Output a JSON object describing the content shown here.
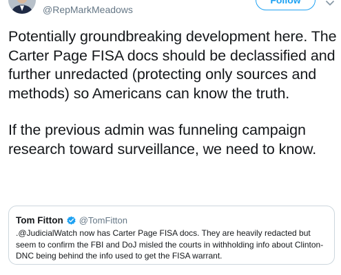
{
  "author": {
    "handle": "@RepMarkMeadows"
  },
  "follow_button": {
    "label": "Follow"
  },
  "tweet": {
    "paragraphs": [
      "Potentially groundbreaking development here. The Carter Page FISA docs should be declassified and further unredacted (protecting only sources and methods) so Americans can know the truth.",
      "If the previous admin was funneling campaign research toward surveillance, we need to know."
    ]
  },
  "quoted_tweet": {
    "name": "Tom Fitton",
    "verified": true,
    "handle": "@TomFitton",
    "text": ".@JudicialWatch now has Carter Page FISA docs. They are heavily redacted but seem to confirm the FBI and DoJ misled the courts in withholding info about Clinton-DNC being behind the info used to get the FISA warrant."
  },
  "icons": {
    "avatar": "avatar-photo",
    "menu": "chevron-down-icon",
    "verified": "verified-badge-icon"
  },
  "colors": {
    "accent": "#1da1f2",
    "text_primary": "#14171a",
    "text_secondary": "#657786",
    "border": "#ccd6dd"
  }
}
